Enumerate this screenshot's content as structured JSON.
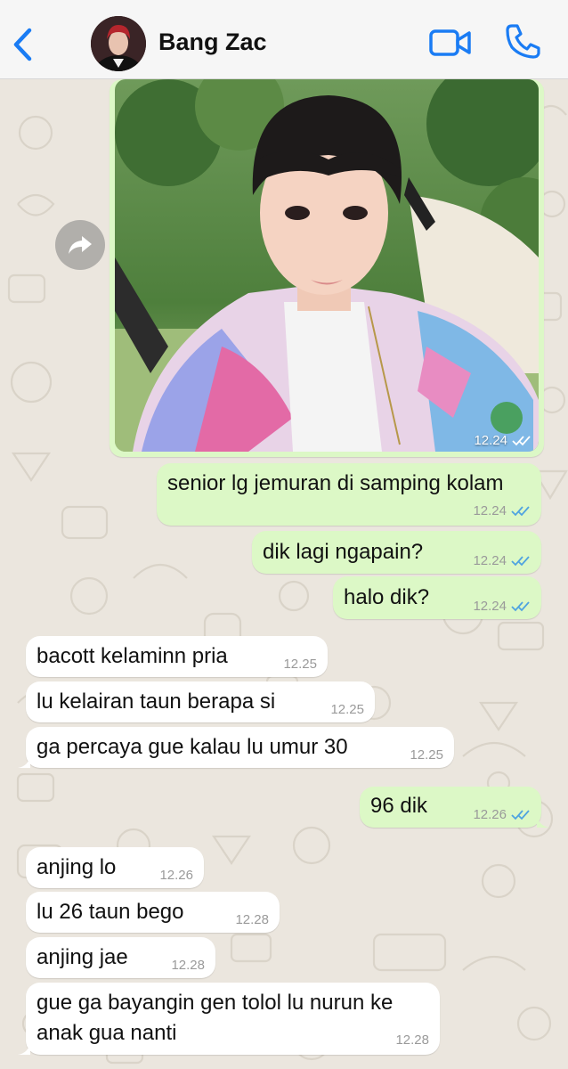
{
  "header": {
    "contact_name": "Bang Zac",
    "back_icon": "chevron-left-icon",
    "video_icon": "video-camera-icon",
    "call_icon": "phone-icon",
    "accent_color": "#1a7cf4"
  },
  "photo_message": {
    "time": "12.24",
    "status": "read"
  },
  "messages": [
    {
      "direction": "out",
      "text": "senior lg jemuran di samping kolam",
      "time": "12.24",
      "status": "read"
    },
    {
      "direction": "out",
      "text": "dik lagi ngapain?",
      "time": "12.24",
      "status": "read"
    },
    {
      "direction": "out",
      "text": "halo dik?",
      "time": "12.24",
      "status": "read"
    },
    {
      "direction": "in",
      "text": "bacott kelaminn pria",
      "time": "12.25"
    },
    {
      "direction": "in",
      "text": "lu kelairan taun berapa si",
      "time": "12.25"
    },
    {
      "direction": "in",
      "text": "ga percaya gue kalau lu umur 30",
      "time": "12.25"
    },
    {
      "direction": "out",
      "text": "96 dik",
      "time": "12.26",
      "status": "read"
    },
    {
      "direction": "in",
      "text": "anjing lo",
      "time": "12.26"
    },
    {
      "direction": "in",
      "text": "lu 26 taun bego",
      "time": "12.28"
    },
    {
      "direction": "in",
      "text": "anjing jae",
      "time": "12.28"
    },
    {
      "direction": "in",
      "text_line1": "gue ga bayangin gen tolol lu nurun ke",
      "text_line2": "anak gua nanti",
      "time": "12.28"
    }
  ],
  "colors": {
    "outgoing_bubble": "#dcf8c6",
    "incoming_bubble": "#ffffff",
    "read_ticks": "#4fa3e0",
    "chat_background": "#ebe6de"
  }
}
